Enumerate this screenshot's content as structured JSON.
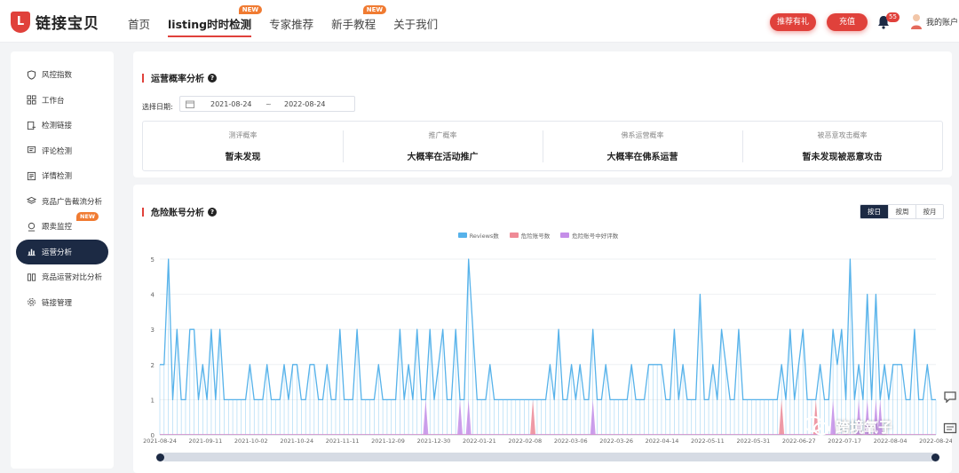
{
  "header": {
    "logo_mark": "L",
    "brand": "链接宝贝",
    "nav": [
      {
        "label": "首页",
        "badge": ""
      },
      {
        "label": "listing时时检测",
        "badge": "NEW"
      },
      {
        "label": "专家推荐",
        "badge": ""
      },
      {
        "label": "新手教程",
        "badge": "NEW"
      },
      {
        "label": "关于我们",
        "badge": ""
      }
    ],
    "btn_invite": "推荐有礼",
    "btn_recharge": "充值",
    "notification_count": "55",
    "account_label": "我的账户"
  },
  "sidebar": {
    "items": [
      {
        "label": "风控指数",
        "icon": "shield-icon"
      },
      {
        "label": "工作台",
        "icon": "grid-icon"
      },
      {
        "label": "检测链接",
        "icon": "link-check-icon"
      },
      {
        "label": "评论检测",
        "icon": "comment-icon"
      },
      {
        "label": "详情检测",
        "icon": "detail-icon"
      },
      {
        "label": "竞品广告截流分析",
        "icon": "layers-icon"
      },
      {
        "label": "跟卖监控",
        "icon": "monitor-icon",
        "badge": "NEW"
      },
      {
        "label": "运营分析",
        "icon": "bar-chart-icon"
      },
      {
        "label": "竞品运营对比分析",
        "icon": "compare-icon"
      },
      {
        "label": "链接管理",
        "icon": "gear-icon"
      }
    ],
    "active_index": 7
  },
  "ops": {
    "title": "运营概率分析",
    "date_label": "选择日期:",
    "date_start": "2021-08-24",
    "date_sep": "~",
    "date_end": "2022-08-24",
    "stats": [
      {
        "label": "测评概率",
        "value": "暂未发现"
      },
      {
        "label": "推广概率",
        "value": "大概率在活动推广"
      },
      {
        "label": "佛系运营概率",
        "value": "大概率在佛系运营"
      },
      {
        "label": "被恶意攻击概率",
        "value": "暂未发现被恶意攻击"
      }
    ]
  },
  "risk": {
    "title": "危险账号分析",
    "tabs": [
      "按日",
      "按周",
      "按月"
    ],
    "active_tab": 0
  },
  "watermark": "跨境氧子",
  "colors": {
    "accent": "#e0413b",
    "navy": "#1c2a44",
    "reviews": "#56b2ea",
    "danger": "#ef8a96",
    "danger_good": "#c58ee8"
  },
  "chart_data": {
    "type": "line",
    "x_ticks": [
      "2021-08-24",
      "2021-09-11",
      "2021-10-02",
      "2021-10-24",
      "2021-11-11",
      "2021-12-09",
      "2021-12-30",
      "2022-01-21",
      "2022-02-08",
      "2022-03-06",
      "2022-03-26",
      "2022-04-14",
      "2022-05-11",
      "2022-05-31",
      "2022-06-27",
      "2022-07-17",
      "2022-08-04",
      "2022-08-24"
    ],
    "ylim": [
      0,
      5
    ],
    "y_ticks": [
      "0",
      "1",
      "2",
      "3",
      "4",
      "5"
    ],
    "grid": true,
    "legend_position": "top-center",
    "series": [
      {
        "name": "Reviews数",
        "color": "#56b2ea",
        "values": [
          2,
          2,
          5,
          1,
          3,
          1,
          1,
          3,
          3,
          1,
          2,
          1,
          3,
          1,
          3,
          1,
          1,
          1,
          1,
          1,
          1,
          2,
          1,
          1,
          1,
          2,
          1,
          1,
          1,
          2,
          1,
          2,
          2,
          1,
          1,
          2,
          2,
          1,
          1,
          2,
          1,
          1,
          3,
          1,
          1,
          1,
          3,
          1,
          1,
          1,
          1,
          2,
          1,
          1,
          1,
          1,
          3,
          1,
          2,
          1,
          3,
          1,
          1,
          3,
          1,
          2,
          3,
          1,
          1,
          3,
          1,
          1,
          5,
          3,
          1,
          1,
          1,
          2,
          1,
          1,
          1,
          1,
          1,
          1,
          1,
          1,
          1,
          1,
          1,
          1,
          1,
          2,
          1,
          3,
          1,
          1,
          2,
          1,
          2,
          1,
          1,
          3,
          1,
          1,
          2,
          1,
          1,
          1,
          1,
          1,
          2,
          1,
          1,
          1,
          2,
          2,
          2,
          2,
          1,
          1,
          3,
          1,
          2,
          1,
          1,
          1,
          4,
          1,
          1,
          2,
          1,
          3,
          2,
          1,
          1,
          3,
          1,
          1,
          1,
          1,
          1,
          1,
          1,
          1,
          1,
          2,
          1,
          3,
          1,
          2,
          3,
          1,
          1,
          1,
          2,
          1,
          1,
          3,
          2,
          3,
          1,
          5,
          1,
          2,
          1,
          4,
          1,
          4,
          1,
          2,
          1,
          2,
          2,
          2,
          1,
          1,
          3,
          1,
          1,
          2,
          1,
          1
        ]
      },
      {
        "name": "危险账号数",
        "color": "#ef8a96",
        "values": [
          0,
          0,
          0,
          0,
          0,
          0,
          0,
          0,
          0,
          0,
          0,
          0,
          0,
          0,
          0,
          0,
          0,
          0,
          0,
          0,
          0,
          0,
          0,
          0,
          0,
          0,
          0,
          0,
          0,
          0,
          0,
          0,
          0,
          0,
          0,
          0,
          0,
          0,
          0,
          0,
          0,
          0,
          0,
          0,
          0,
          0,
          0,
          0,
          0,
          0,
          0,
          0,
          0,
          0,
          0,
          0,
          0,
          0,
          0,
          0,
          0,
          0,
          0,
          0,
          0,
          0,
          0,
          0,
          0,
          0,
          0,
          0,
          0,
          0,
          0,
          0,
          0,
          0,
          0,
          0,
          0,
          0,
          0,
          0,
          0,
          0,
          0,
          1,
          0,
          0,
          0,
          0,
          0,
          0,
          0,
          0,
          0,
          0,
          0,
          0,
          0,
          0,
          0,
          0,
          0,
          0,
          0,
          0,
          0,
          0,
          0,
          0,
          0,
          0,
          0,
          0,
          0,
          0,
          0,
          0,
          0,
          0,
          0,
          0,
          0,
          0,
          0,
          0,
          0,
          0,
          0,
          0,
          0,
          0,
          0,
          0,
          0,
          0,
          0,
          0,
          0,
          0,
          0,
          0,
          0,
          1,
          0,
          0,
          0,
          0,
          0,
          0,
          0,
          1,
          0,
          0,
          0,
          0,
          0,
          0,
          0,
          0,
          0,
          0,
          0,
          0,
          0,
          0,
          0,
          0,
          0,
          0,
          0,
          0,
          0,
          0,
          0,
          0,
          0,
          0,
          0,
          0,
          0,
          0,
          0,
          0,
          0
        ]
      },
      {
        "name": "危险账号中好评数",
        "color": "#c58ee8",
        "values": [
          0,
          0,
          0,
          0,
          0,
          0,
          0,
          0,
          0,
          0,
          0,
          0,
          0,
          0,
          0,
          0,
          0,
          0,
          0,
          0,
          0,
          0,
          0,
          0,
          0,
          0,
          0,
          0,
          0,
          0,
          0,
          0,
          0,
          0,
          0,
          0,
          0,
          0,
          0,
          0,
          0,
          0,
          0,
          0,
          0,
          0,
          0,
          0,
          0,
          0,
          0,
          0,
          0,
          0,
          0,
          0,
          0,
          0,
          0,
          0,
          0,
          0,
          1,
          0,
          0,
          0,
          0,
          0,
          0,
          0,
          1,
          0,
          1,
          0,
          0,
          0,
          0,
          0,
          0,
          0,
          0,
          0,
          0,
          0,
          0,
          0,
          0,
          0,
          0,
          0,
          0,
          0,
          0,
          0,
          0,
          0,
          0,
          0,
          0,
          0,
          0,
          1,
          0,
          0,
          0,
          0,
          0,
          0,
          0,
          0,
          0,
          0,
          0,
          0,
          0,
          0,
          0,
          0,
          0,
          0,
          0,
          0,
          0,
          0,
          0,
          0,
          0,
          0,
          0,
          0,
          0,
          0,
          0,
          0,
          0,
          0,
          0,
          0,
          0,
          0,
          0,
          0,
          0,
          0,
          0,
          0,
          0,
          0,
          0,
          0,
          0,
          0,
          0,
          0,
          0,
          0,
          0,
          1,
          0,
          0,
          0,
          0,
          0,
          1,
          0,
          1,
          0,
          1,
          1,
          0,
          0,
          0,
          0,
          0,
          0,
          0,
          0,
          0,
          0,
          0,
          0,
          0,
          0,
          0,
          0,
          0,
          0,
          0,
          0
        ]
      }
    ]
  }
}
